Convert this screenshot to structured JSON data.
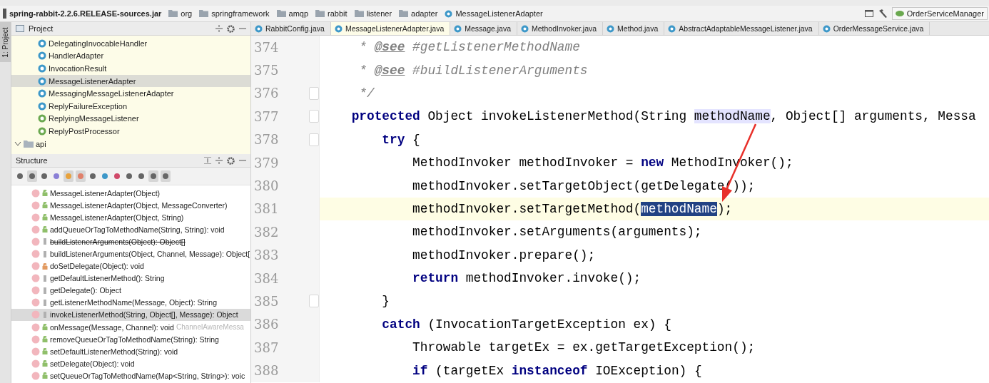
{
  "breadcrumbs": [
    {
      "kind": "jar",
      "label": "spring-rabbit-2.2.6.RELEASE-sources.jar"
    },
    {
      "kind": "package",
      "label": "org"
    },
    {
      "kind": "package",
      "label": "springframework"
    },
    {
      "kind": "package",
      "label": "amqp"
    },
    {
      "kind": "package",
      "label": "rabbit"
    },
    {
      "kind": "package",
      "label": "listener"
    },
    {
      "kind": "package",
      "label": "adapter"
    },
    {
      "kind": "class",
      "label": "MessageListenerAdapter"
    }
  ],
  "run_config": {
    "label": "OrderServiceManager"
  },
  "side_stripe": {
    "label": "1: Project"
  },
  "project": {
    "title": "Project",
    "items": [
      {
        "kind": "class",
        "label": "DelegatingInvocableHandler",
        "selected": false
      },
      {
        "kind": "class",
        "label": "HandlerAdapter",
        "selected": false
      },
      {
        "kind": "class",
        "label": "InvocationResult",
        "selected": false
      },
      {
        "kind": "class",
        "label": "MessageListenerAdapter",
        "selected": true
      },
      {
        "kind": "class",
        "label": "MessagingMessageListenerAdapter",
        "selected": false
      },
      {
        "kind": "class",
        "label": "ReplyFailureException",
        "selected": false
      },
      {
        "kind": "interface",
        "label": "ReplyingMessageListener",
        "selected": false
      },
      {
        "kind": "interface",
        "label": "ReplyPostProcessor",
        "selected": false
      },
      {
        "kind": "folder",
        "label": "api",
        "selected": false
      }
    ]
  },
  "structure": {
    "title": "Structure",
    "tools": [
      {
        "kind": "sort-visibility",
        "on": false
      },
      {
        "kind": "sort-alpha",
        "on": true
      },
      {
        "kind": "inherited",
        "on": false
      },
      {
        "kind": "properties",
        "on": false
      },
      {
        "kind": "fields",
        "on": true
      },
      {
        "kind": "non-public",
        "on": true
      },
      {
        "kind": "hierarchy",
        "on": false
      },
      {
        "kind": "anonymous",
        "on": false
      },
      {
        "kind": "lambdas",
        "on": false
      },
      {
        "kind": "expand",
        "on": false
      },
      {
        "kind": "collapse",
        "on": false
      },
      {
        "kind": "autoscroll-to",
        "on": true
      },
      {
        "kind": "autoscroll-from",
        "on": true
      }
    ],
    "items": [
      {
        "kind": "public",
        "label": "MessageListenerAdapter(Object)",
        "deprecated": false,
        "selected": false
      },
      {
        "kind": "public",
        "label": "MessageListenerAdapter(Object, MessageConverter)",
        "deprecated": false,
        "selected": false
      },
      {
        "kind": "public",
        "label": "MessageListenerAdapter(Object, String)",
        "deprecated": false,
        "selected": false
      },
      {
        "kind": "public",
        "label": "addQueueOrTagToMethodName(String, String): void",
        "deprecated": false,
        "selected": false
      },
      {
        "kind": "protected",
        "label": "buildListenerArguments(Object): Object[]",
        "deprecated": true,
        "selected": false
      },
      {
        "kind": "protected",
        "label": "buildListenerArguments(Object, Channel, Message): Object[",
        "deprecated": false,
        "selected": false
      },
      {
        "kind": "private",
        "label": "doSetDelegate(Object): void",
        "deprecated": false,
        "selected": false
      },
      {
        "kind": "protected",
        "label": "getDefaultListenerMethod(): String",
        "deprecated": false,
        "selected": false
      },
      {
        "kind": "protected",
        "label": "getDelegate(): Object",
        "deprecated": false,
        "selected": false
      },
      {
        "kind": "protected",
        "label": "getListenerMethodName(Message, Object): String",
        "deprecated": false,
        "selected": false
      },
      {
        "kind": "protected",
        "label": "invokeListenerMethod(String, Object[], Message): Object",
        "deprecated": false,
        "selected": true
      },
      {
        "kind": "public",
        "label": "onMessage(Message, Channel): void",
        "suffix": "ChannelAwareMessa",
        "deprecated": false,
        "selected": false
      },
      {
        "kind": "public",
        "label": "removeQueueOrTagToMethodName(String): String",
        "deprecated": false,
        "selected": false
      },
      {
        "kind": "public",
        "label": "setDefaultListenerMethod(String): void",
        "deprecated": false,
        "selected": false
      },
      {
        "kind": "public",
        "label": "setDelegate(Object): void",
        "deprecated": false,
        "selected": false
      },
      {
        "kind": "public",
        "label": "setQueueOrTagToMethodName(Map<String, String>): voic",
        "deprecated": false,
        "selected": false
      }
    ]
  },
  "tabs": [
    {
      "label": "RabbitConfig.java",
      "selected": false
    },
    {
      "label": "MessageListenerAdapter.java",
      "selected": true
    },
    {
      "label": "Message.java",
      "selected": false
    },
    {
      "label": "MethodInvoker.java",
      "selected": false
    },
    {
      "label": "Method.java",
      "selected": false
    },
    {
      "label": "AbstractAdaptableMessageListener.java",
      "selected": false
    },
    {
      "label": "OrderMessageService.java",
      "selected": false
    }
  ],
  "code": [
    {
      "number": "374",
      "current": false,
      "fold": false,
      "tokens": [
        {
          "kind": "comment",
          "text": "     * "
        },
        {
          "kind": "doctag",
          "text": "@see"
        },
        {
          "kind": "comment",
          "text": " #getListenerMethodName"
        }
      ]
    },
    {
      "number": "375",
      "current": false,
      "fold": false,
      "tokens": [
        {
          "kind": "comment",
          "text": "     * "
        },
        {
          "kind": "doctag",
          "text": "@see"
        },
        {
          "kind": "comment",
          "text": " #buildListenerArguments"
        }
      ]
    },
    {
      "number": "376",
      "current": false,
      "fold": true,
      "tokens": [
        {
          "kind": "comment",
          "text": "     */"
        }
      ]
    },
    {
      "number": "377",
      "current": false,
      "fold": true,
      "tokens": [
        {
          "kind": "keyword",
          "text": "    protected"
        },
        {
          "kind": "plain",
          "text": " Object invokeListenerMethod(String "
        },
        {
          "kind": "highlight",
          "text": "methodName"
        },
        {
          "kind": "plain",
          "text": ", Object[] arguments, Messa"
        }
      ]
    },
    {
      "number": "378",
      "current": false,
      "fold": true,
      "tokens": [
        {
          "kind": "keyword",
          "text": "        try"
        },
        {
          "kind": "plain",
          "text": " {"
        }
      ]
    },
    {
      "number": "379",
      "current": false,
      "fold": false,
      "tokens": [
        {
          "kind": "plain",
          "text": "            MethodInvoker methodInvoker = "
        },
        {
          "kind": "keyword",
          "text": "new"
        },
        {
          "kind": "plain",
          "text": " MethodInvoker();"
        }
      ]
    },
    {
      "number": "380",
      "current": false,
      "fold": false,
      "tokens": [
        {
          "kind": "plain",
          "text": "            methodInvoker.setTargetObject(getDelegate());"
        }
      ]
    },
    {
      "number": "381",
      "current": true,
      "fold": false,
      "tokens": [
        {
          "kind": "plain",
          "text": "            methodInvoker.setTargetMethod("
        },
        {
          "kind": "selection",
          "text": "methodName"
        },
        {
          "kind": "plain",
          "text": ");"
        }
      ]
    },
    {
      "number": "382",
      "current": false,
      "fold": false,
      "tokens": [
        {
          "kind": "plain",
          "text": "            methodInvoker.setArguments(arguments);"
        }
      ]
    },
    {
      "number": "383",
      "current": false,
      "fold": false,
      "tokens": [
        {
          "kind": "plain",
          "text": "            methodInvoker.prepare();"
        }
      ]
    },
    {
      "number": "384",
      "current": false,
      "fold": false,
      "tokens": [
        {
          "kind": "keyword",
          "text": "            return"
        },
        {
          "kind": "plain",
          "text": " methodInvoker.invoke();"
        }
      ]
    },
    {
      "number": "385",
      "current": false,
      "fold": true,
      "tokens": [
        {
          "kind": "plain",
          "text": "        }"
        }
      ]
    },
    {
      "number": "386",
      "current": false,
      "fold": false,
      "tokens": [
        {
          "kind": "keyword",
          "text": "        catch"
        },
        {
          "kind": "plain",
          "text": " (InvocationTargetException ex) {"
        }
      ]
    },
    {
      "number": "387",
      "current": false,
      "fold": false,
      "tokens": [
        {
          "kind": "plain",
          "text": "            Throwable targetEx = ex.getTargetException();"
        }
      ]
    },
    {
      "number": "388",
      "current": false,
      "fold": false,
      "tokens": [
        {
          "kind": "keyword",
          "text": "            if"
        },
        {
          "kind": "plain",
          "text": " (targetEx "
        },
        {
          "kind": "keyword",
          "text": "instanceof"
        },
        {
          "kind": "plain",
          "text": " IOException) {"
        }
      ]
    }
  ]
}
